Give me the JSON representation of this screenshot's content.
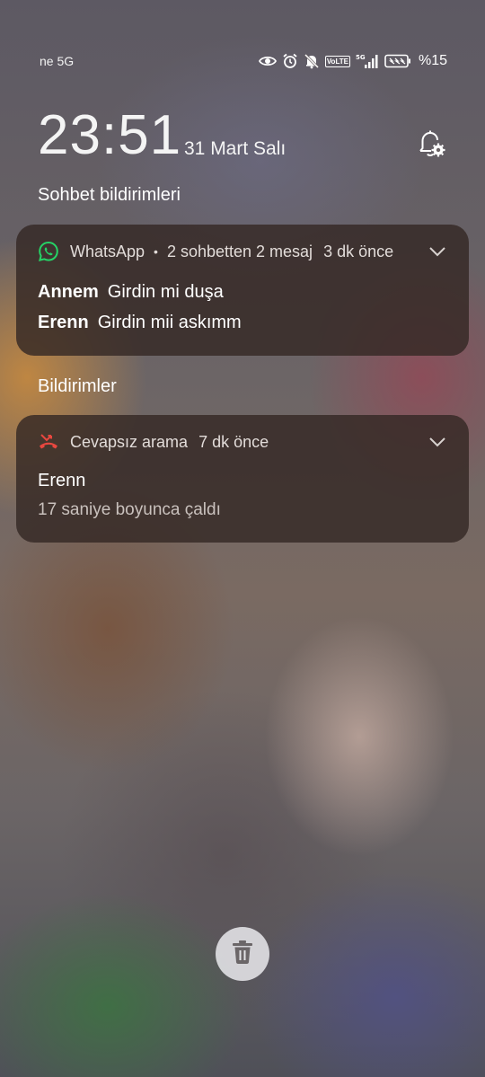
{
  "status_bar": {
    "carrier": "ne 5G",
    "volte_label": "VoLTE",
    "battery_percent": "%15",
    "icons": [
      "eye-icon",
      "alarm-icon",
      "bell-off-icon",
      "volte-icon",
      "signal-5g-icon",
      "battery-saver-icon"
    ]
  },
  "lockscreen": {
    "time": "23:51",
    "date": "31 Mart Salı"
  },
  "sections": {
    "chat_title": "Sohbet bildirimleri",
    "notifications_title": "Bildirimler"
  },
  "whatsapp_card": {
    "app_name": "WhatsApp",
    "separator": "•",
    "summary": "2 sohbetten 2 mesaj",
    "time": "3 dk önce",
    "messages": [
      {
        "sender": "Annem",
        "text": "Girdin mi duşa"
      },
      {
        "sender": "Erenn",
        "text": "Girdin mii askımm"
      }
    ]
  },
  "missed_call_card": {
    "title": "Cevapsız arama",
    "time": "7 dk önce",
    "caller": "Erenn",
    "detail": "17 saniye boyunca çaldı"
  },
  "colors": {
    "whatsapp_green": "#25D366",
    "missed_call_red": "#E8473F",
    "card_bg": "#34282499"
  }
}
